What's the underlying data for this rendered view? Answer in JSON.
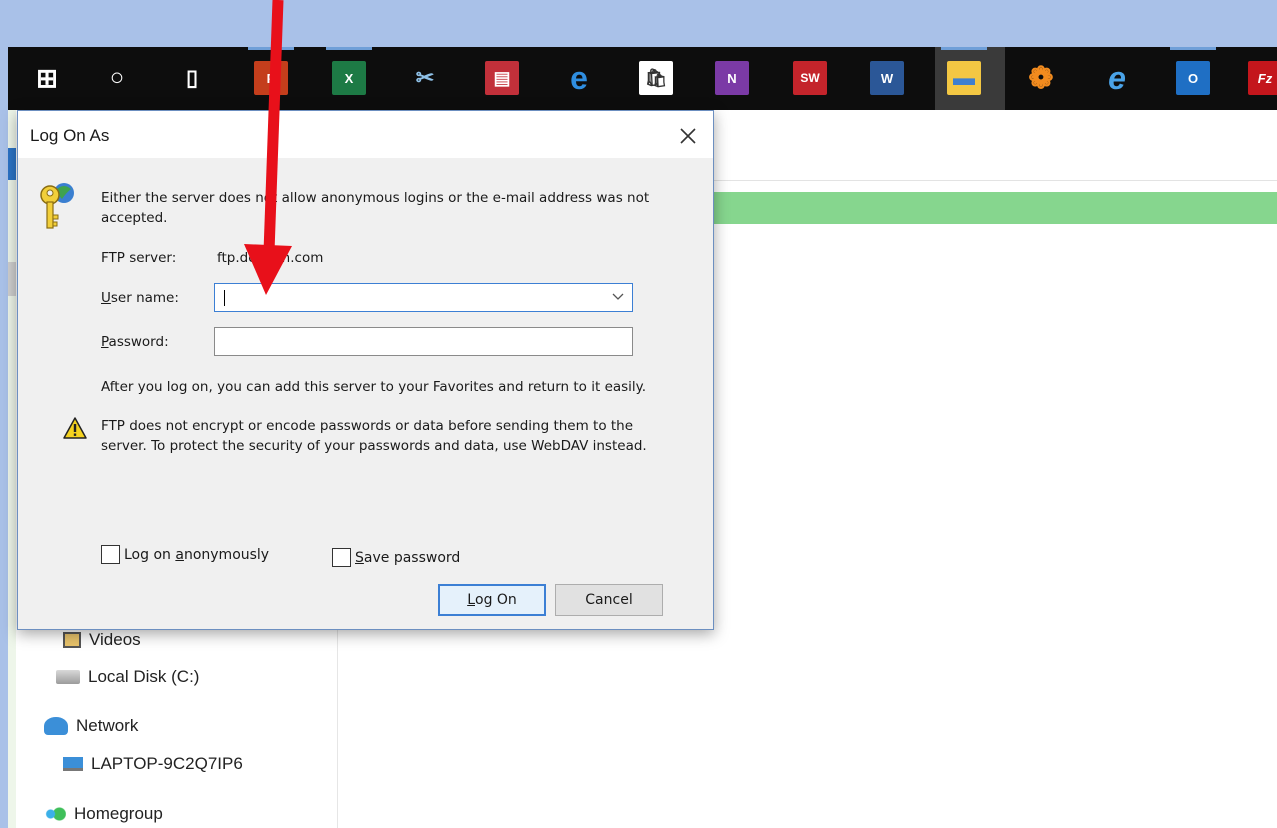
{
  "dialog": {
    "title": "Log On As",
    "message": "Either the server does not allow anonymous logins or the e-mail address was not accepted.",
    "message_line1": "Either the server does not allow anonymous logins or the e-mail address was not",
    "message_line2": "accepted.",
    "ftp_server_label": "FTP server:",
    "ftp_server_value": "ftp.domain.com",
    "username_label_pre": "",
    "username_label_u": "U",
    "username_label_post": "ser name:",
    "username_value": "",
    "password_label_u": "P",
    "password_label_post": "assword:",
    "password_value": "",
    "favorites_text": "After you log on, you can add this server to your Favorites and return to it easily.",
    "warning_line1": "FTP does not encrypt or encode passwords or data before sending them to the",
    "warning_line2": "server.  To protect the security of your passwords and data, use WebDAV instead.",
    "anon_pre": "Log on ",
    "anon_u": "a",
    "anon_post": "nonymously",
    "save_u": "S",
    "save_post": "ave password",
    "logon_u": "L",
    "logon_post": "og On",
    "cancel_label": "Cancel"
  },
  "taskbar": {
    "icons": [
      {
        "name": "windows-start-icon",
        "glyph": "⊞"
      },
      {
        "name": "cortana-icon",
        "glyph": "○"
      },
      {
        "name": "task-view-icon",
        "glyph": "▯"
      },
      {
        "name": "powerpoint-icon",
        "glyph": "P"
      },
      {
        "name": "excel-icon",
        "glyph": "X"
      },
      {
        "name": "snipping-tool-icon",
        "glyph": "✂"
      },
      {
        "name": "publisher-icon",
        "glyph": "▤"
      },
      {
        "name": "edge-icon",
        "glyph": "e"
      },
      {
        "name": "store-icon",
        "glyph": "🛍"
      },
      {
        "name": "onenote-icon",
        "glyph": "N"
      },
      {
        "name": "solidworks-icon",
        "glyph": "SW"
      },
      {
        "name": "word-icon",
        "glyph": "W"
      },
      {
        "name": "file-explorer-icon",
        "glyph": "▬"
      },
      {
        "name": "flower-app-icon",
        "glyph": "❁"
      },
      {
        "name": "internet-explorer-icon",
        "glyph": "e"
      },
      {
        "name": "outlook-icon",
        "glyph": "O"
      },
      {
        "name": "filezilla-icon",
        "glyph": "Fz"
      }
    ]
  },
  "explorer": {
    "nav": [
      {
        "label": "Videos"
      },
      {
        "label": "Local Disk (C:)"
      },
      {
        "label": "Network"
      },
      {
        "label": "LAPTOP-9C2Q7IP6"
      },
      {
        "label": "Homegroup"
      }
    ]
  },
  "colors": {
    "accent": "#3c7fd4",
    "arrow": "#e8101a",
    "progress": "#86d68e",
    "taskbar": "#0d0d0d"
  }
}
